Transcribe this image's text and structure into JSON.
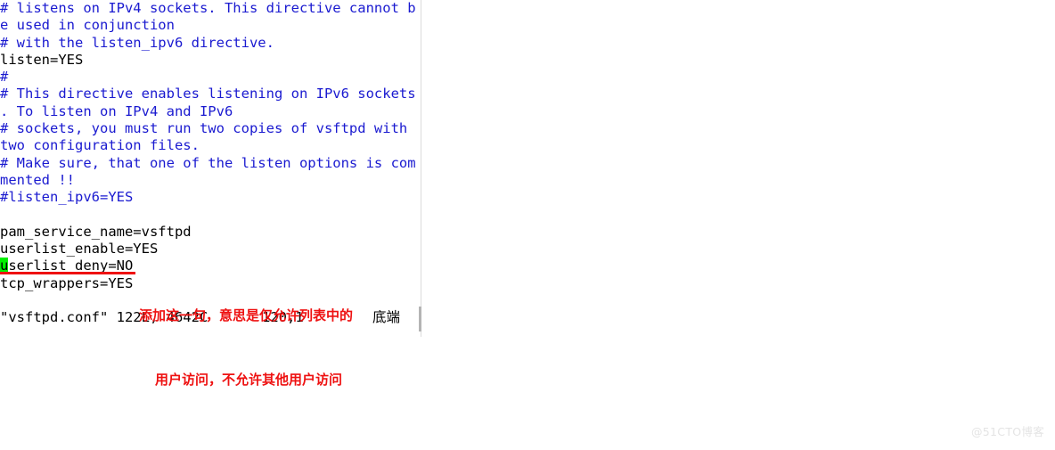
{
  "editor": {
    "name": "vim",
    "filename": "vsftpd.conf",
    "background_color": "#ffffff",
    "comment_color": "#1a1ad0",
    "code_color": "#000000",
    "cursor_color": "#00ef00",
    "annotation_color": "#ee1111",
    "lines": [
      {
        "id": "l1",
        "type": "comment",
        "text": "# listens on IPv4 sockets. This directive cannot b"
      },
      {
        "id": "l2",
        "type": "comment",
        "text": "e used in conjunction"
      },
      {
        "id": "l3",
        "type": "comment",
        "text": "# with the listen_ipv6 directive."
      },
      {
        "id": "l4",
        "type": "code",
        "text": "listen=YES"
      },
      {
        "id": "l5",
        "type": "comment",
        "text": "#"
      },
      {
        "id": "l6",
        "type": "comment",
        "text": "# This directive enables listening on IPv6 sockets"
      },
      {
        "id": "l7",
        "type": "comment",
        "text": ". To listen on IPv4 and IPv6"
      },
      {
        "id": "l8",
        "type": "comment",
        "text": "# sockets, you must run two copies of vsftpd with"
      },
      {
        "id": "l9",
        "type": "comment",
        "text": "two configuration files."
      },
      {
        "id": "l10",
        "type": "comment",
        "text": "# Make sure, that one of the listen options is com"
      },
      {
        "id": "l11",
        "type": "comment",
        "text": "mented !!"
      },
      {
        "id": "l12",
        "type": "comment",
        "text": "#listen_ipv6=YES"
      },
      {
        "id": "l13",
        "type": "blank",
        "text": ""
      },
      {
        "id": "l14",
        "type": "code",
        "text": "pam_service_name=vsftpd"
      },
      {
        "id": "l15",
        "type": "code",
        "text": "userlist_enable=YES"
      },
      {
        "id": "l16",
        "type": "code",
        "text": "userlist_deny=NO",
        "cursor_index": 0
      },
      {
        "id": "l17",
        "type": "code",
        "text": "tcp_wrappers=YES"
      }
    ],
    "status": {
      "file_info": "\"vsftpd.conf\" 122L, 4642C",
      "position": "120,1",
      "scroll_state": "底端"
    }
  },
  "annotation": {
    "line_1": "添加这一句，意思是仅允许列表中的",
    "line_2": "用户访问，不允许其他用户访问",
    "underline_present": true
  },
  "watermark": {
    "text": "@51CTO博客"
  }
}
